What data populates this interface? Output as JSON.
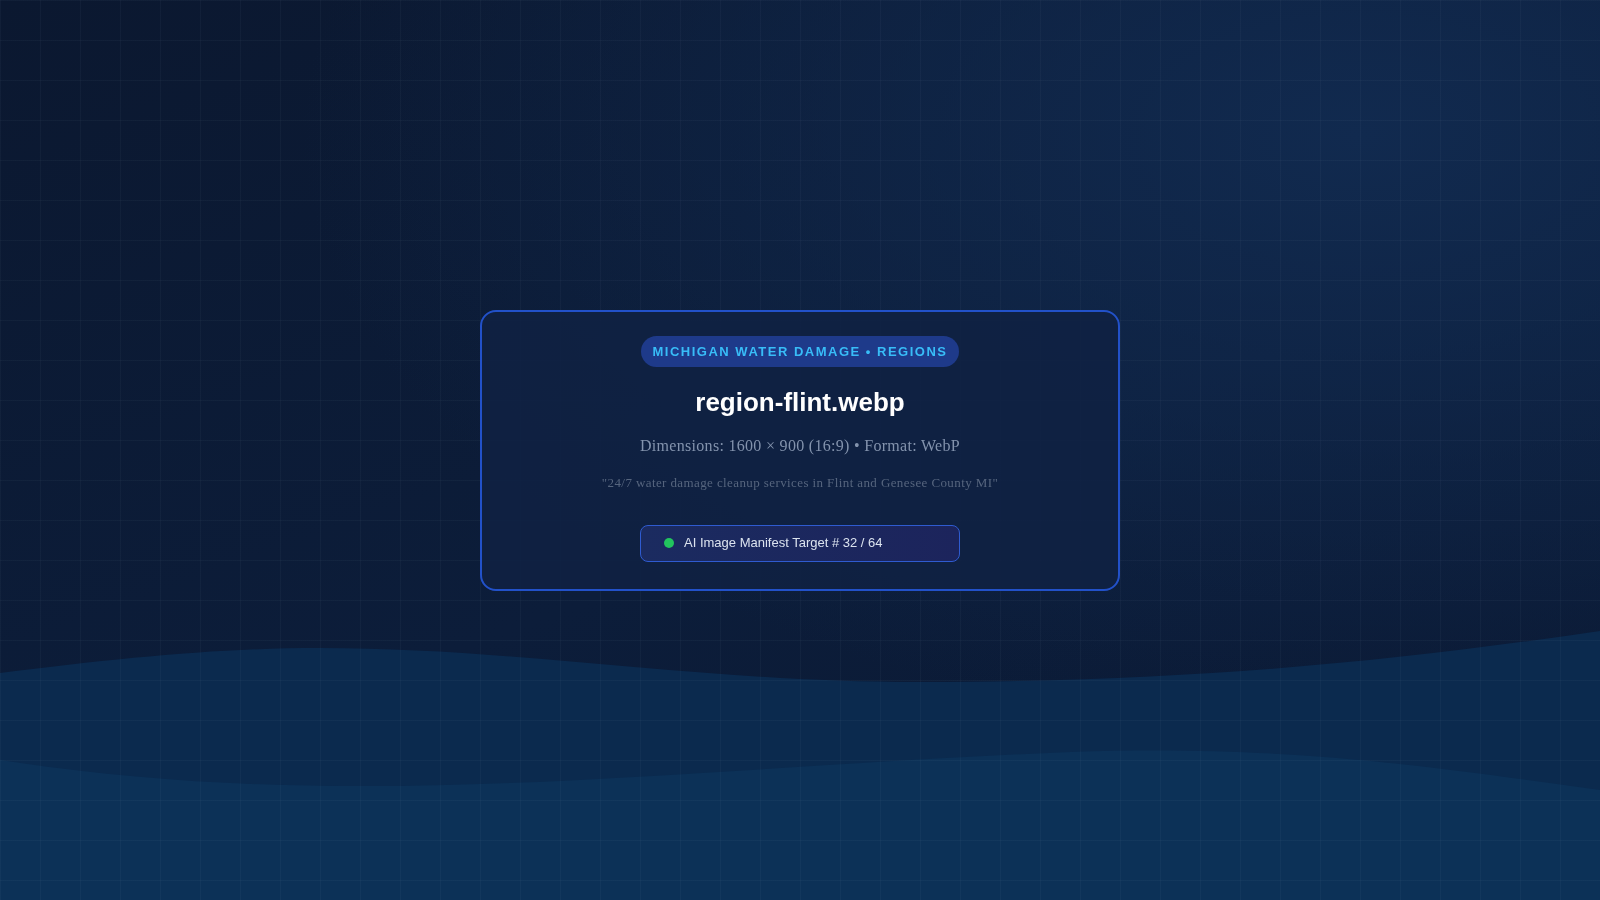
{
  "badge": {
    "text": "MICHIGAN WATER DAMAGE • REGIONS"
  },
  "title": "region-flint.webp",
  "dimensions": "Dimensions: 1600 × 900 (16:9) • Format: WebP",
  "caption": "\"24/7 water damage cleanup services in Flint and Genesee County MI\"",
  "manifest": {
    "online": true,
    "label": "AI Image Manifest Target # 32 / 64"
  }
}
